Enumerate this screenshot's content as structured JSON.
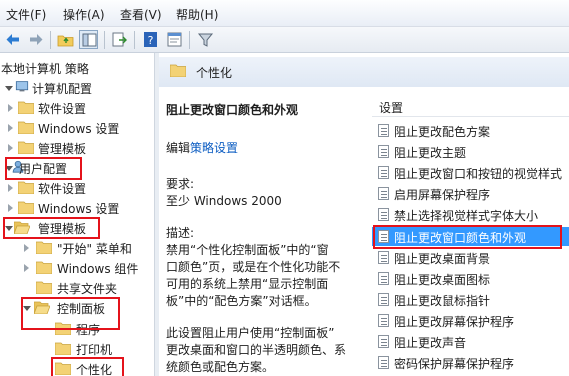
{
  "menu": [
    "文件(F)",
    "操作(A)",
    "查看(V)",
    "帮助(H)"
  ],
  "tree": {
    "root": "本地计算机 策略",
    "computer_config": "计算机配置",
    "software_settings_1": "软件设置",
    "windows_settings_1": "Windows 设置",
    "admin_templates_1": "管理模板",
    "user_config": "用户配置",
    "software_settings_2": "软件设置",
    "windows_settings_2": "Windows 设置",
    "admin_templates_2": "管理模板",
    "start_menu": "\"开始\" 菜单和",
    "windows_components": "Windows 组件",
    "shared_folders": "共享文件夹",
    "control_panel": "控制面板",
    "programs": "程序",
    "printers": "打印机",
    "personalization": "个性化"
  },
  "header_title": "个性化",
  "description": {
    "title": "阻止更改窗口颜色和外观",
    "edit_prefix": "编辑",
    "edit_link": "策略设置",
    "req_label": "要求:",
    "req_value": "至少 Windows 2000",
    "desc_label": "描述:",
    "desc_lines": [
      "禁用“个性化控制面板”中的“窗",
      "口颜色”页，或是在个性化功能不",
      "可用的系统上禁用“显示控制面",
      "板”中的“配色方案”对话框。"
    ],
    "more_lines": [
      "此设置阻止用户使用“控制面板”",
      "更改桌面和窗口的半透明颜色、系",
      "统颜色或配色方案。"
    ]
  },
  "settings_header": "设置",
  "settings": [
    "阻止更改配色方案",
    "阻止更改主题",
    "阻止更改窗口和按钮的视觉样式",
    "启用屏幕保护程序",
    "禁止选择视觉样式字体大小",
    "阻止更改窗口颜色和外观",
    "阻止更改桌面背景",
    "阻止更改桌面图标",
    "阻止更改鼠标指针",
    "阻止更改屏幕保护程序",
    "阻止更改声音",
    "密码保护屏幕保护程序"
  ],
  "colors": {
    "highlight": "#3399ff",
    "annotation_red": "#e4131b",
    "folder": "#f3d275"
  }
}
